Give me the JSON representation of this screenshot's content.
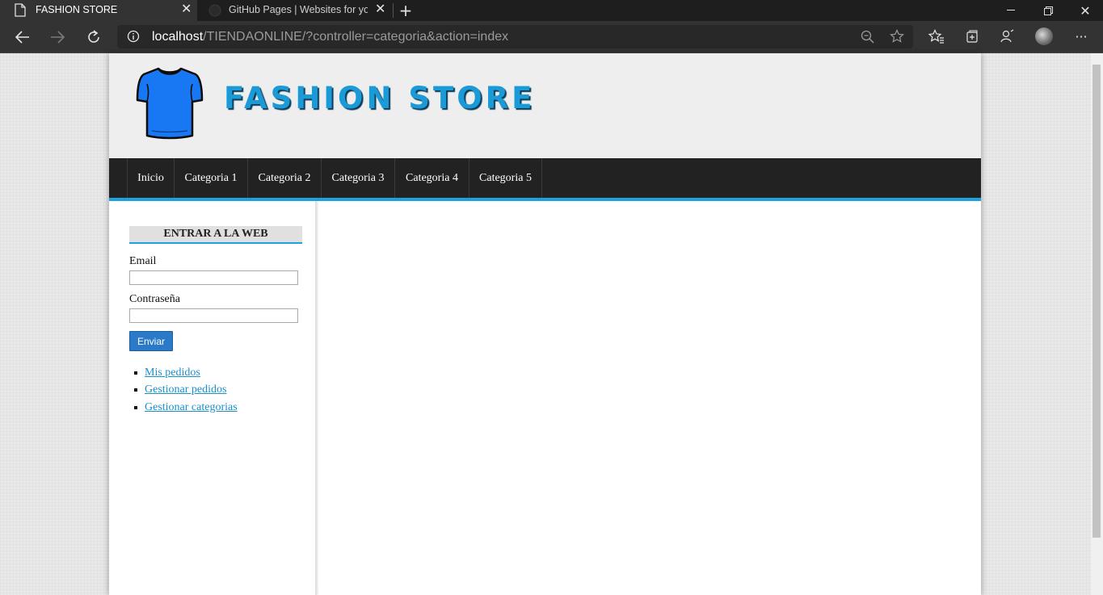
{
  "browser": {
    "tabs": [
      {
        "title": "FASHION STORE",
        "active": true
      },
      {
        "title": "GitHub Pages | Websites for you",
        "active": false
      }
    ],
    "url_host": "localhost",
    "url_path": "/TIENDAONLINE/?controller=categoria&action=index",
    "icons": {
      "back": "back-arrow-icon",
      "forward": "forward-arrow-icon",
      "refresh": "refresh-icon",
      "info": "info-icon",
      "zoom": "zoom-icon",
      "favorite": "star-icon",
      "favorites": "favorites-icon",
      "collections": "collections-icon",
      "read_aloud": "read-aloud-icon",
      "profile": "avatar",
      "more": "more-icon"
    }
  },
  "site": {
    "brand": "FASHION STORE",
    "logo_icon": "tshirt-icon",
    "nav": [
      "Inicio",
      "Categoria 1",
      "Categoria 2",
      "Categoria 3",
      "Categoria 4",
      "Categoria 5"
    ],
    "login": {
      "title": "ENTRAR A LA WEB",
      "email_label": "Email",
      "password_label": "Contraseña",
      "email_value": "",
      "password_value": "",
      "submit_label": "Enviar"
    },
    "menu": [
      "Mis pedidos",
      "Gestionar pedidos",
      "Gestionar categorias"
    ]
  },
  "colors": {
    "accent": "#1aa3de",
    "brand_text": "#1a9bd7",
    "nav_bg": "#222222",
    "button": "#2a7ac9",
    "tshirt": "#1877f2"
  }
}
